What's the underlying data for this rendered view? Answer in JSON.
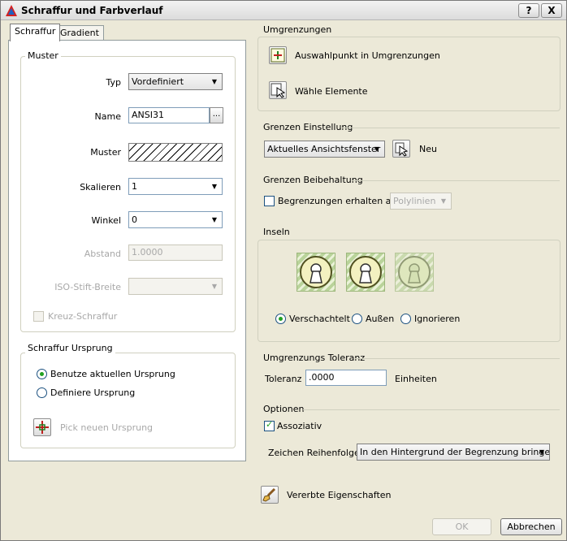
{
  "window": {
    "title": "Schraffur und Farbverlauf",
    "help": "?",
    "close": "X"
  },
  "tabs": [
    {
      "label": "Schraffur"
    },
    {
      "label": "Gradient"
    }
  ],
  "muster": {
    "title": "Muster",
    "typ": {
      "label": "Typ",
      "value": "Vordefiniert"
    },
    "name": {
      "label": "Name",
      "value": "ANSI31",
      "browse": "..."
    },
    "muster_label": "Muster",
    "skalieren": {
      "label": "Skalieren",
      "value": "1"
    },
    "winkel": {
      "label": "Winkel",
      "value": "0"
    },
    "abstand": {
      "label": "Abstand",
      "value": "1.0000"
    },
    "iso": {
      "label": "ISO-Stift-Breite",
      "value": ""
    },
    "kreuz": {
      "label": "Kreuz-Schraffur",
      "checked": false
    }
  },
  "ursprung": {
    "title": "Schraffur Ursprung",
    "opt_current": "Benutze aktuellen Ursprung",
    "opt_define": "Definiere Ursprung",
    "pick": "Pick neuen Ursprung"
  },
  "umgrenzungen": {
    "title": "Umgrenzungen",
    "auswahlpunkt": "Auswahlpunkt in Umgrenzungen",
    "waehle": "Wähle Elemente"
  },
  "grenzen_einstellung": {
    "title": "Grenzen Einstellung",
    "value": "Aktuelles Ansichtsfenster",
    "neu": "Neu"
  },
  "grenzen_beibehaltung": {
    "title": "Grenzen Beibehaltung",
    "label": "Begrenzungen erhalten als",
    "value": "Polylinien"
  },
  "inseln": {
    "title": "Inseln",
    "options": [
      "Verschachtelt",
      "Außen",
      "Ignorieren"
    ],
    "selected": "Verschachtelt"
  },
  "toleranz": {
    "title": "Umgrenzungs Toleranz",
    "label": "Toleranz",
    "value": ".0000",
    "unit": "Einheiten"
  },
  "optionen": {
    "title": "Optionen",
    "assoziativ": "Assoziativ",
    "reihenfolge_label": "Zeichen Reihenfolge",
    "reihenfolge_value": "In den Hintergrund der Begrenzung bringen"
  },
  "vererbte": "Vererbte Eigenschaften",
  "buttons": {
    "ok": "OK",
    "cancel": "Abbrechen"
  },
  "colors": {
    "accent_green": "#21a121",
    "panel_bg": "#ece9d8",
    "tab_bg": "#ffffff"
  }
}
